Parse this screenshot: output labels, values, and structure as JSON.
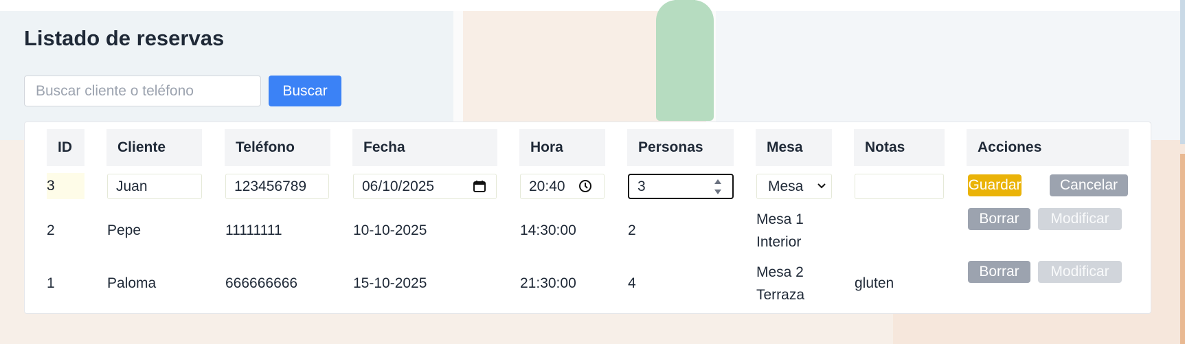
{
  "title": "Listado de reservas",
  "search": {
    "placeholder": "Buscar cliente o teléfono",
    "button_label": "Buscar"
  },
  "table": {
    "headers": [
      "ID",
      "Cliente",
      "Teléfono",
      "Fecha",
      "Hora",
      "Personas",
      "Mesa",
      "Notas",
      "Acciones"
    ],
    "edit_row": {
      "id": "3",
      "cliente": "Juan",
      "telefono": "123456789",
      "fecha": "06/10/2025",
      "hora": "20:40",
      "personas": "3",
      "mesa": "Mesa",
      "notas": "",
      "save_label": "Guardar",
      "cancel_label": "Cancelar"
    },
    "rows": [
      {
        "id": "2",
        "cliente": "Pepe",
        "telefono": "11111111",
        "fecha": "10-10-2025",
        "hora": "14:30:00",
        "personas": "2",
        "mesa_line1": "Mesa 1",
        "mesa_line2": "Interior",
        "notas": "",
        "delete_label": "Borrar",
        "edit_label": "Modificar"
      },
      {
        "id": "1",
        "cliente": "Paloma",
        "telefono": "666666666",
        "fecha": "15-10-2025",
        "hora": "21:30:00",
        "personas": "4",
        "mesa_line1": "Mesa 2",
        "mesa_line2": "Terraza",
        "notas": "gluten",
        "delete_label": "Borrar",
        "edit_label": "Modificar"
      }
    ]
  },
  "colors": {
    "primary_button": "#3b82f6",
    "save_button": "#eab308",
    "secondary_button": "#9ca3af",
    "disabled_button": "#d1d5db"
  },
  "icons": [
    "calendar-icon",
    "clock-icon",
    "spinner-arrows-icon",
    "chevron-down-icon"
  ]
}
